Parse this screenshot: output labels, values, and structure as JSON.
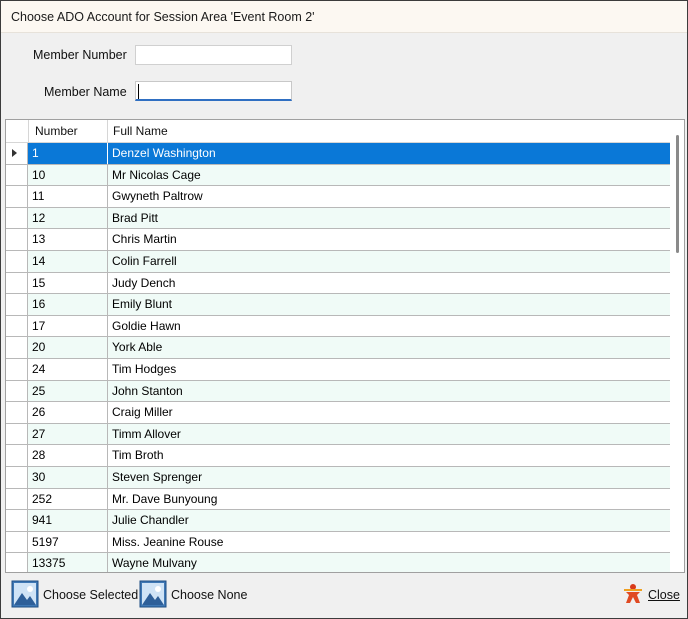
{
  "window": {
    "title": "Choose ADO Account for Session Area 'Event Room 2'"
  },
  "form": {
    "member_number_label": "Member Number",
    "member_number_value": "",
    "member_name_label": "Member Name",
    "member_name_value": ""
  },
  "grid": {
    "columns": [
      "Number",
      "Full Name"
    ],
    "selected_index": 0,
    "rows": [
      {
        "number": "1",
        "full_name": "Denzel Washington"
      },
      {
        "number": "10",
        "full_name": "Mr Nicolas Cage"
      },
      {
        "number": "11",
        "full_name": "Gwyneth Paltrow"
      },
      {
        "number": "12",
        "full_name": "Brad Pitt"
      },
      {
        "number": "13",
        "full_name": "Chris Martin"
      },
      {
        "number": "14",
        "full_name": "Colin Farrell"
      },
      {
        "number": "15",
        "full_name": "Judy Dench"
      },
      {
        "number": "16",
        "full_name": "Emily Blunt"
      },
      {
        "number": "17",
        "full_name": "Goldie Hawn"
      },
      {
        "number": "20",
        "full_name": "York Able"
      },
      {
        "number": "24",
        "full_name": "Tim Hodges"
      },
      {
        "number": "25",
        "full_name": "John Stanton"
      },
      {
        "number": "26",
        "full_name": "Craig Miller"
      },
      {
        "number": "27",
        "full_name": "Timm Allover"
      },
      {
        "number": "28",
        "full_name": "Tim Broth"
      },
      {
        "number": "30",
        "full_name": "Steven Sprenger"
      },
      {
        "number": "252",
        "full_name": "Mr. Dave Bunyoung"
      },
      {
        "number": "941",
        "full_name": "Julie Chandler"
      },
      {
        "number": "5197",
        "full_name": "Miss. Jeanine Rouse"
      },
      {
        "number": "13375",
        "full_name": "Wayne Mulvany"
      }
    ]
  },
  "toolbar": {
    "choose_selected_label": "Choose Selected",
    "choose_none_label": "Choose None",
    "close_label": "Close"
  },
  "colors": {
    "selection": "#0a78d7",
    "alt_row": "#f0fbf7",
    "input_focus": "#2f6fc2"
  },
  "icons": {
    "choose_selected": "picture-icon",
    "choose_none": "picture-icon",
    "close": "close-icon"
  }
}
